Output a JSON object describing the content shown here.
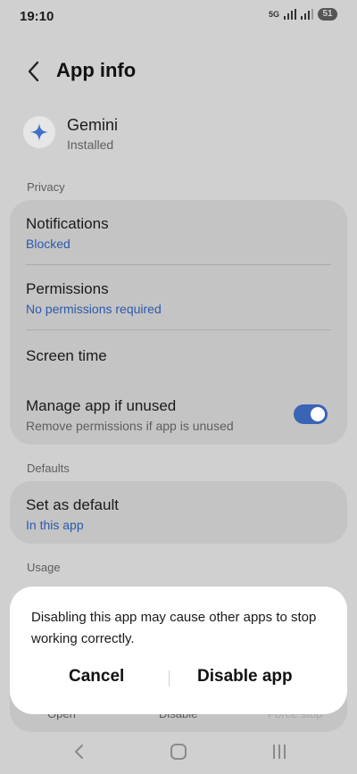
{
  "status_bar": {
    "time": "19:10",
    "network": "5G",
    "battery": "51"
  },
  "header": {
    "title": "App info"
  },
  "app": {
    "name": "Gemini",
    "status": "Installed",
    "icon": "gemini-sparkle-icon"
  },
  "privacy": {
    "label": "Privacy",
    "notifications": {
      "title": "Notifications",
      "value": "Blocked"
    },
    "permissions": {
      "title": "Permissions",
      "value": "No permissions required"
    },
    "screen_time": {
      "title": "Screen time"
    },
    "manage_unused": {
      "title": "Manage app if unused",
      "subtitle": "Remove permissions if app is unused",
      "enabled": true
    }
  },
  "defaults": {
    "label": "Defaults",
    "set_default": {
      "title": "Set as default",
      "value": "In this app"
    }
  },
  "usage": {
    "label": "Usage"
  },
  "bottom_actions": {
    "open": "Open",
    "disable": "Disable",
    "force_stop": "Force stop"
  },
  "dialog": {
    "message": "Disabling this app may cause other apps to stop working correctly.",
    "cancel": "Cancel",
    "confirm": "Disable app"
  },
  "colors": {
    "accent": "#3a64b6",
    "link": "#2c59ad",
    "scrim_background": "#d0d0d0",
    "card": "#c4c4c4"
  }
}
